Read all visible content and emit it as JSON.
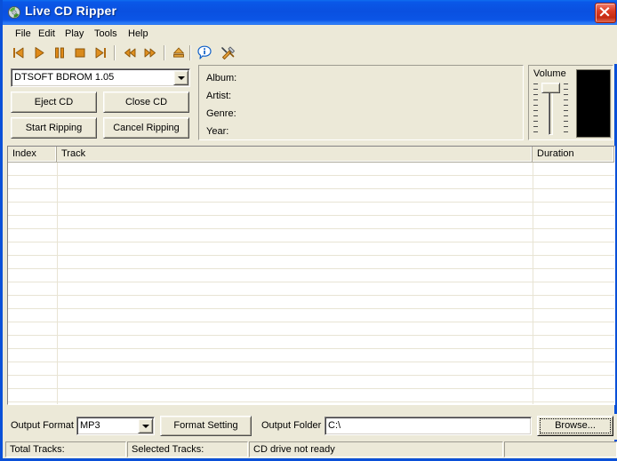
{
  "window": {
    "title": "Live CD Ripper",
    "icon": "cd-disc-icon",
    "close_label": "close-icon",
    "frame_color": "#0a50d8",
    "titlebar_color": "#0a50e0",
    "face_color": "#ece9d8"
  },
  "menubar": {
    "items": [
      {
        "label": "File"
      },
      {
        "label": "Edit"
      },
      {
        "label": "Play"
      },
      {
        "label": "Tools"
      },
      {
        "label": "Help"
      }
    ]
  },
  "toolbar": {
    "buttons": [
      {
        "name": "previous-track-icon",
        "title": "Previous Track"
      },
      {
        "name": "play-icon",
        "title": "Play"
      },
      {
        "name": "pause-icon",
        "title": "Pause"
      },
      {
        "name": "stop-icon",
        "title": "Stop"
      },
      {
        "name": "next-track-icon",
        "title": "Next Track"
      },
      {
        "name": "rewind-icon",
        "title": "Rewind"
      },
      {
        "name": "fast-forward-icon",
        "title": "Fast Forward"
      },
      {
        "name": "eject-icon",
        "title": "Eject"
      },
      {
        "name": "info-icon",
        "title": "About"
      },
      {
        "name": "tools-icon",
        "title": "Tools"
      }
    ]
  },
  "drive": {
    "selected": "DTSOFT BDROM 1.05",
    "buttons": {
      "eject": "Eject CD",
      "close": "Close CD",
      "start": "Start Ripping",
      "cancel": "Cancel Ripping"
    }
  },
  "album": {
    "fields": [
      {
        "label": "Album:",
        "value": ""
      },
      {
        "label": "Artist:",
        "value": ""
      },
      {
        "label": "Genre:",
        "value": ""
      },
      {
        "label": "Year:",
        "value": ""
      }
    ]
  },
  "volume": {
    "label": "Volume",
    "level": 88
  },
  "tracklist": {
    "columns": [
      {
        "label": "Index"
      },
      {
        "label": "Track"
      },
      {
        "label": "Duration"
      }
    ],
    "rows": []
  },
  "output": {
    "format_label": "Output Format",
    "format_value": "MP3",
    "format_setting_label": "Format Setting",
    "folder_label": "Output Folder",
    "folder_value": "C:\\",
    "browse_label": "Browse..."
  },
  "statusbar": {
    "panels": [
      {
        "text": "Total Tracks:"
      },
      {
        "text": "Selected Tracks:"
      },
      {
        "text": "CD drive not ready"
      },
      {
        "text": ""
      }
    ]
  }
}
